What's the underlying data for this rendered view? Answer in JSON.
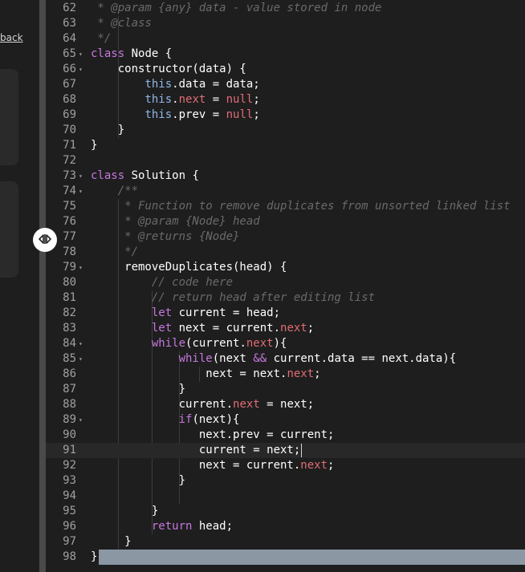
{
  "left_panel": {
    "feedback_label": "back"
  },
  "colors": {
    "background": "#1e1e1e",
    "comment": "#6a6a6a",
    "keyword": "#c678dd",
    "property": "#e06c75",
    "this": "#8fb7e6"
  },
  "splitter": {
    "icon": "resize-horizontal-icon"
  },
  "editor": {
    "active_line": 91,
    "selected_line": 98,
    "lines": [
      {
        "n": "62",
        "fold": false,
        "parts": [
          [
            "c",
            " * @param {any} data - value stored in node"
          ]
        ]
      },
      {
        "n": "63",
        "fold": false,
        "parts": [
          [
            "c",
            " * @class"
          ]
        ]
      },
      {
        "n": "64",
        "fold": false,
        "parts": [
          [
            "c",
            " */"
          ]
        ]
      },
      {
        "n": "65",
        "fold": true,
        "parts": [
          [
            "k",
            "class"
          ],
          [
            "t",
            " Node {"
          ]
        ]
      },
      {
        "n": "66",
        "fold": true,
        "parts": [
          [
            "t",
            "    constructor(data) {"
          ]
        ]
      },
      {
        "n": "67",
        "fold": false,
        "parts": [
          [
            "t",
            "        "
          ],
          [
            "h",
            "this"
          ],
          [
            "t",
            ".data = data;"
          ]
        ]
      },
      {
        "n": "68",
        "fold": false,
        "parts": [
          [
            "t",
            "        "
          ],
          [
            "h",
            "this"
          ],
          [
            "t",
            "."
          ],
          [
            "p",
            "next"
          ],
          [
            "t",
            " = "
          ],
          [
            "p",
            "null"
          ],
          [
            "t",
            ";"
          ]
        ]
      },
      {
        "n": "69",
        "fold": false,
        "parts": [
          [
            "t",
            "        "
          ],
          [
            "h",
            "this"
          ],
          [
            "t",
            ".prev = "
          ],
          [
            "p",
            "null"
          ],
          [
            "t",
            ";"
          ]
        ]
      },
      {
        "n": "70",
        "fold": false,
        "parts": [
          [
            "t",
            "    }"
          ]
        ]
      },
      {
        "n": "71",
        "fold": false,
        "parts": [
          [
            "t",
            "}"
          ]
        ]
      },
      {
        "n": "72",
        "fold": false,
        "parts": [
          [
            "t",
            ""
          ]
        ]
      },
      {
        "n": "73",
        "fold": true,
        "parts": [
          [
            "k",
            "class"
          ],
          [
            "t",
            " Solution {"
          ]
        ]
      },
      {
        "n": "74",
        "fold": true,
        "parts": [
          [
            "c",
            "    /**"
          ]
        ]
      },
      {
        "n": "75",
        "fold": false,
        "parts": [
          [
            "c",
            "     * Function to remove duplicates from unsorted linked list"
          ]
        ]
      },
      {
        "n": "76",
        "fold": false,
        "parts": [
          [
            "c",
            "     * @param {Node} head"
          ]
        ]
      },
      {
        "n": "77",
        "fold": false,
        "parts": [
          [
            "c",
            "     * @returns {Node}"
          ]
        ]
      },
      {
        "n": "78",
        "fold": false,
        "parts": [
          [
            "c",
            "     */"
          ]
        ]
      },
      {
        "n": "79",
        "fold": true,
        "parts": [
          [
            "t",
            "     removeDuplicates(head) {"
          ]
        ]
      },
      {
        "n": "80",
        "fold": false,
        "parts": [
          [
            "c",
            "         // code here"
          ]
        ]
      },
      {
        "n": "81",
        "fold": false,
        "parts": [
          [
            "c",
            "         // return head after editing list"
          ]
        ]
      },
      {
        "n": "82",
        "fold": false,
        "parts": [
          [
            "t",
            "         "
          ],
          [
            "k",
            "let"
          ],
          [
            "t",
            " current = head;"
          ]
        ]
      },
      {
        "n": "83",
        "fold": false,
        "parts": [
          [
            "t",
            "         "
          ],
          [
            "k",
            "let"
          ],
          [
            "t",
            " next = current."
          ],
          [
            "p",
            "next"
          ],
          [
            "t",
            ";"
          ]
        ]
      },
      {
        "n": "84",
        "fold": true,
        "parts": [
          [
            "t",
            "         "
          ],
          [
            "k",
            "while"
          ],
          [
            "t",
            "(current."
          ],
          [
            "p",
            "next"
          ],
          [
            "t",
            "){"
          ]
        ]
      },
      {
        "n": "85",
        "fold": true,
        "parts": [
          [
            "t",
            "             "
          ],
          [
            "k",
            "while"
          ],
          [
            "t",
            "(next "
          ],
          [
            "k",
            "&&"
          ],
          [
            "t",
            " current.data == next.data){"
          ]
        ]
      },
      {
        "n": "86",
        "fold": false,
        "parts": [
          [
            "t",
            "                 next = next."
          ],
          [
            "p",
            "next"
          ],
          [
            "t",
            ";"
          ]
        ]
      },
      {
        "n": "87",
        "fold": false,
        "parts": [
          [
            "t",
            "             }"
          ]
        ]
      },
      {
        "n": "88",
        "fold": false,
        "parts": [
          [
            "t",
            "             current."
          ],
          [
            "p",
            "next"
          ],
          [
            "t",
            " = next;"
          ]
        ]
      },
      {
        "n": "89",
        "fold": true,
        "parts": [
          [
            "t",
            "             "
          ],
          [
            "k",
            "if"
          ],
          [
            "t",
            "(next){"
          ]
        ]
      },
      {
        "n": "90",
        "fold": false,
        "parts": [
          [
            "t",
            "                next.prev = current;"
          ]
        ]
      },
      {
        "n": "91",
        "fold": false,
        "parts": [
          [
            "t",
            "                current = next;"
          ]
        ]
      },
      {
        "n": "92",
        "fold": false,
        "parts": [
          [
            "t",
            "                next = current."
          ],
          [
            "p",
            "next"
          ],
          [
            "t",
            ";"
          ]
        ]
      },
      {
        "n": "93",
        "fold": false,
        "parts": [
          [
            "t",
            "             }"
          ]
        ]
      },
      {
        "n": "94",
        "fold": false,
        "parts": [
          [
            "t",
            ""
          ]
        ]
      },
      {
        "n": "95",
        "fold": false,
        "parts": [
          [
            "t",
            "         }"
          ]
        ]
      },
      {
        "n": "96",
        "fold": false,
        "parts": [
          [
            "t",
            "         "
          ],
          [
            "k",
            "return"
          ],
          [
            "t",
            " head;"
          ]
        ]
      },
      {
        "n": "97",
        "fold": false,
        "parts": [
          [
            "t",
            "     }"
          ]
        ]
      },
      {
        "n": "98",
        "fold": false,
        "parts": [
          [
            "t",
            "}"
          ]
        ]
      }
    ]
  }
}
